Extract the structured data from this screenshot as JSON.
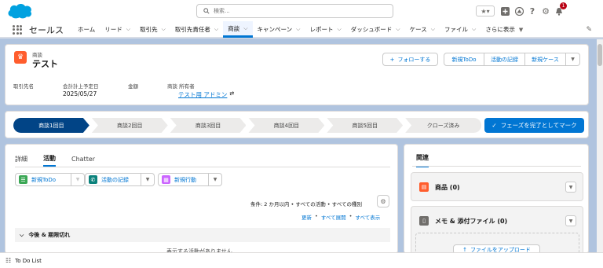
{
  "header": {
    "search_placeholder": "検索...",
    "notification_count": "1",
    "icons": [
      "favorites-star-icon",
      "add-icon",
      "trailhead-icon",
      "help-icon",
      "setup-gear-icon",
      "bell-icon"
    ]
  },
  "nav": {
    "app_name": "セールス",
    "items": [
      {
        "label": "ホーム",
        "dropdown": false
      },
      {
        "label": "リード",
        "dropdown": true
      },
      {
        "label": "取引先",
        "dropdown": true
      },
      {
        "label": "取引先責任者",
        "dropdown": true
      },
      {
        "label": "商談",
        "dropdown": true,
        "active": true
      },
      {
        "label": "キャンペーン",
        "dropdown": true
      },
      {
        "label": "レポート",
        "dropdown": true
      },
      {
        "label": "ダッシュボード",
        "dropdown": true
      },
      {
        "label": "ケース",
        "dropdown": true
      },
      {
        "label": "ファイル",
        "dropdown": true
      },
      {
        "label": "さらに表示",
        "dropdown": true
      }
    ]
  },
  "record": {
    "type": "商談",
    "name": "テスト",
    "follow_label": "フォローする",
    "actions": [
      "新規ToDo",
      "活動の記録",
      "新規ケース"
    ],
    "fields": [
      {
        "label": "取引先名",
        "value": ""
      },
      {
        "label": "会計計上予定日",
        "value": "2025/05/27"
      },
      {
        "label": "金額",
        "value": ""
      },
      {
        "label": "商談 所有者",
        "value": "テスト用 アドミン"
      }
    ]
  },
  "path": {
    "stages": [
      "商談1回目",
      "商談2回目",
      "商談3回目",
      "商談4回目",
      "商談5回目",
      "クローズ済み"
    ],
    "current_index": 0,
    "mark_button": "フェーズを完了としてマーク"
  },
  "activity": {
    "tabs": [
      "詳細",
      "活動",
      "Chatter"
    ],
    "active_tab": 1,
    "buttons": [
      {
        "label": "新規ToDo",
        "color": "#3ba755"
      },
      {
        "label": "活動の記録",
        "color": "#0b827c"
      },
      {
        "label": "新規行動",
        "color": "#cb65ff"
      }
    ],
    "filter_text": "条件: 2 か月以内 • すべての活動 • すべての種別",
    "links": [
      "更新",
      "すべて展開",
      "すべて表示"
    ],
    "section_title": "今後 & 期限切れ",
    "empty_text": "表示する活動がありません"
  },
  "related": {
    "title": "関連",
    "items": [
      {
        "label": "商品 (0)",
        "color": "#ff5d2d"
      },
      {
        "label": "メモ & 添付ファイル (0)",
        "color": "#706e6b"
      }
    ],
    "upload_label": "ファイルをアップロード"
  },
  "utility": {
    "todo_list": "To Do List"
  }
}
